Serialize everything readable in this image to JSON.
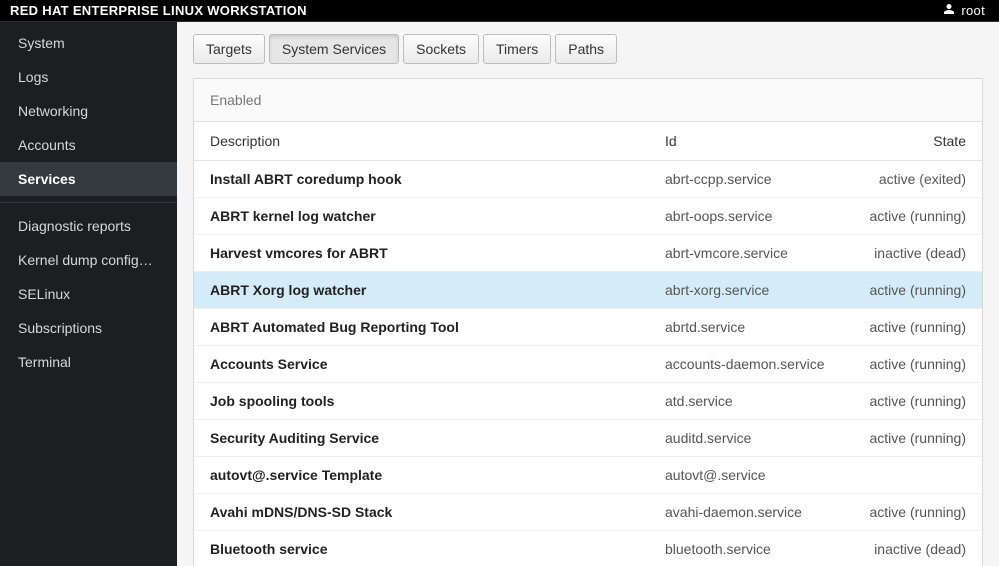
{
  "topbar": {
    "title": "RED HAT ENTERPRISE LINUX WORKSTATION",
    "user": "root"
  },
  "sidebar": {
    "items_top": [
      {
        "label": "System"
      },
      {
        "label": "Logs"
      },
      {
        "label": "Networking"
      },
      {
        "label": "Accounts"
      },
      {
        "label": "Services",
        "active": true
      }
    ],
    "items_bottom": [
      {
        "label": "Diagnostic reports"
      },
      {
        "label": "Kernel dump configura…"
      },
      {
        "label": "SELinux"
      },
      {
        "label": "Subscriptions"
      },
      {
        "label": "Terminal"
      }
    ]
  },
  "tabs": [
    {
      "label": "Targets"
    },
    {
      "label": "System Services",
      "active": true
    },
    {
      "label": "Sockets"
    },
    {
      "label": "Timers"
    },
    {
      "label": "Paths"
    }
  ],
  "panel": {
    "section_label": "Enabled",
    "columns": {
      "desc": "Description",
      "id": "Id",
      "state": "State"
    }
  },
  "services": [
    {
      "desc": "Install ABRT coredump hook",
      "id": "abrt-ccpp.service",
      "state": "active (exited)"
    },
    {
      "desc": "ABRT kernel log watcher",
      "id": "abrt-oops.service",
      "state": "active (running)"
    },
    {
      "desc": "Harvest vmcores for ABRT",
      "id": "abrt-vmcore.service",
      "state": "inactive (dead)"
    },
    {
      "desc": "ABRT Xorg log watcher",
      "id": "abrt-xorg.service",
      "state": "active (running)",
      "highlight": true
    },
    {
      "desc": "ABRT Automated Bug Reporting Tool",
      "id": "abrtd.service",
      "state": "active (running)"
    },
    {
      "desc": "Accounts Service",
      "id": "accounts-daemon.service",
      "state": "active (running)"
    },
    {
      "desc": "Job spooling tools",
      "id": "atd.service",
      "state": "active (running)"
    },
    {
      "desc": "Security Auditing Service",
      "id": "auditd.service",
      "state": "active (running)"
    },
    {
      "desc": "autovt@.service Template",
      "id": "autovt@.service",
      "state": ""
    },
    {
      "desc": "Avahi mDNS/DNS-SD Stack",
      "id": "avahi-daemon.service",
      "state": "active (running)"
    },
    {
      "desc": "Bluetooth service",
      "id": "bluetooth.service",
      "state": "inactive (dead)"
    }
  ]
}
